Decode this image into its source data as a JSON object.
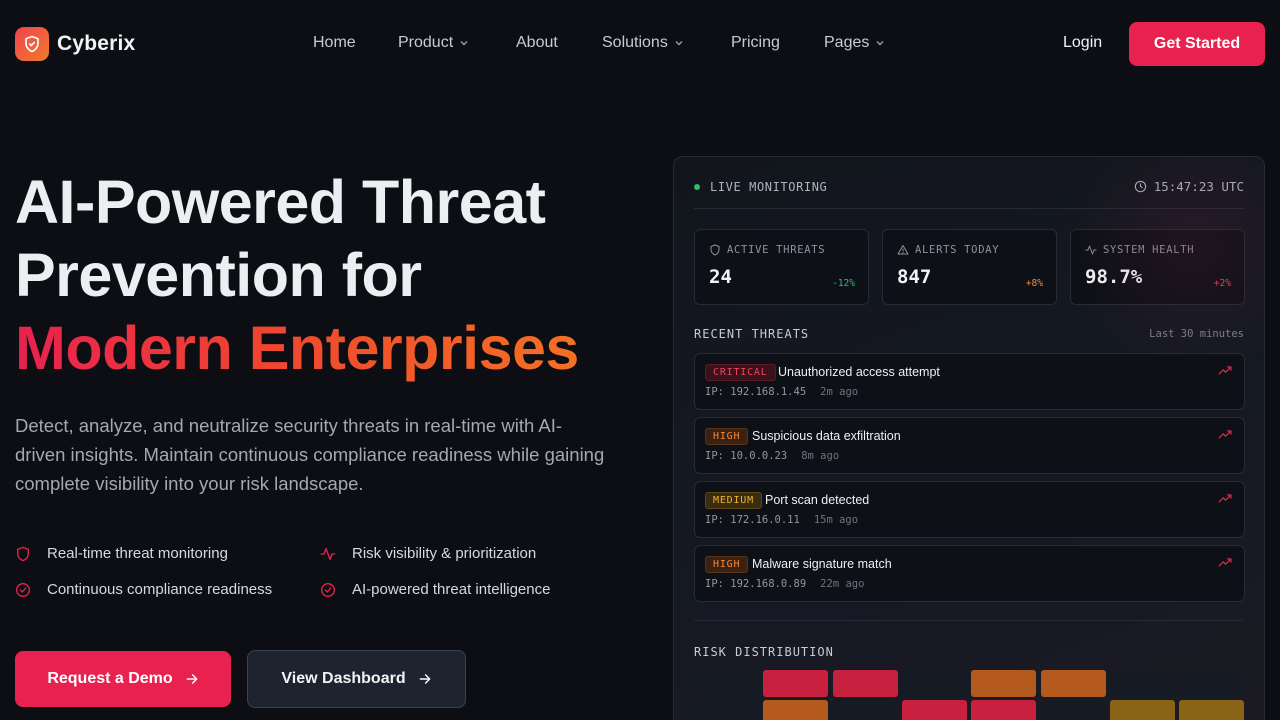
{
  "brand": {
    "name": "Cyberix",
    "accent": "#e8214f",
    "accent_2": "#f47b20"
  },
  "nav": {
    "links": [
      {
        "label": "Home",
        "dropdown": false
      },
      {
        "label": "Product",
        "dropdown": true
      },
      {
        "label": "About",
        "dropdown": false
      },
      {
        "label": "Solutions",
        "dropdown": true
      },
      {
        "label": "Pricing",
        "dropdown": false
      },
      {
        "label": "Pages",
        "dropdown": true
      }
    ],
    "login": "Login",
    "cta": "Get Started"
  },
  "hero": {
    "title_line1": "AI-Powered Threat",
    "title_line2": "Prevention for",
    "title_highlight": "Modern Enterprises",
    "description": "Detect, analyze, and neutralize security threats in real-time with AI-driven insights. Maintain continuous compliance readiness while gaining complete visibility into your risk landscape.",
    "features": [
      {
        "label": "Real-time threat monitoring",
        "icon": "shield-icon"
      },
      {
        "label": "Risk visibility & prioritization",
        "icon": "activity-icon"
      },
      {
        "label": "Continuous compliance readiness",
        "icon": "check-circle-icon"
      },
      {
        "label": "AI-powered threat intelligence",
        "icon": "check-circle-icon"
      }
    ],
    "primary_button": "Request a Demo",
    "secondary_button": "View Dashboard"
  },
  "dashboard": {
    "status": "LIVE MONITORING",
    "time": "15:47:23 UTC",
    "stats": [
      {
        "label": "ACTIVE THREATS",
        "value": "24",
        "delta": "-12%",
        "delta_color": "#22c55e",
        "icon": "shield-icon"
      },
      {
        "label": "ALERTS TODAY",
        "value": "847",
        "delta": "+8%",
        "delta_color": "#f2893a",
        "icon": "alert-triangle-icon"
      },
      {
        "label": "SYSTEM HEALTH",
        "value": "98.7%",
        "delta": "+2%",
        "delta_color": "#f0445f",
        "icon": "activity-icon"
      }
    ],
    "recent_label": "RECENT THREATS",
    "recent_meta": "Last 30 minutes",
    "threats": [
      {
        "severity": "CRITICAL",
        "title": "Unauthorized access attempt",
        "ip": "IP: 192.168.1.45",
        "ago": "2m ago"
      },
      {
        "severity": "HIGH",
        "title": "Suspicious data exfiltration",
        "ip": "IP: 10.0.0.23",
        "ago": "8m ago"
      },
      {
        "severity": "MEDIUM",
        "title": "Port scan detected",
        "ip": "IP: 172.16.0.11",
        "ago": "15m ago"
      },
      {
        "severity": "HIGH",
        "title": "Malware signature match",
        "ip": "IP: 192.168.0.89",
        "ago": "22m ago"
      }
    ],
    "risk_label": "RISK DISTRIBUTION",
    "risk_grid": [
      [
        "none",
        "critical",
        "critical",
        "none",
        "high",
        "high",
        "none",
        "none"
      ],
      [
        "none",
        "high",
        "none",
        "critical",
        "critical",
        "none",
        "medium",
        "medium"
      ]
    ],
    "risk_colors": {
      "none": "#161a22",
      "critical": "#c8213f",
      "high": "#b55a1e",
      "medium": "#8a6416"
    }
  }
}
